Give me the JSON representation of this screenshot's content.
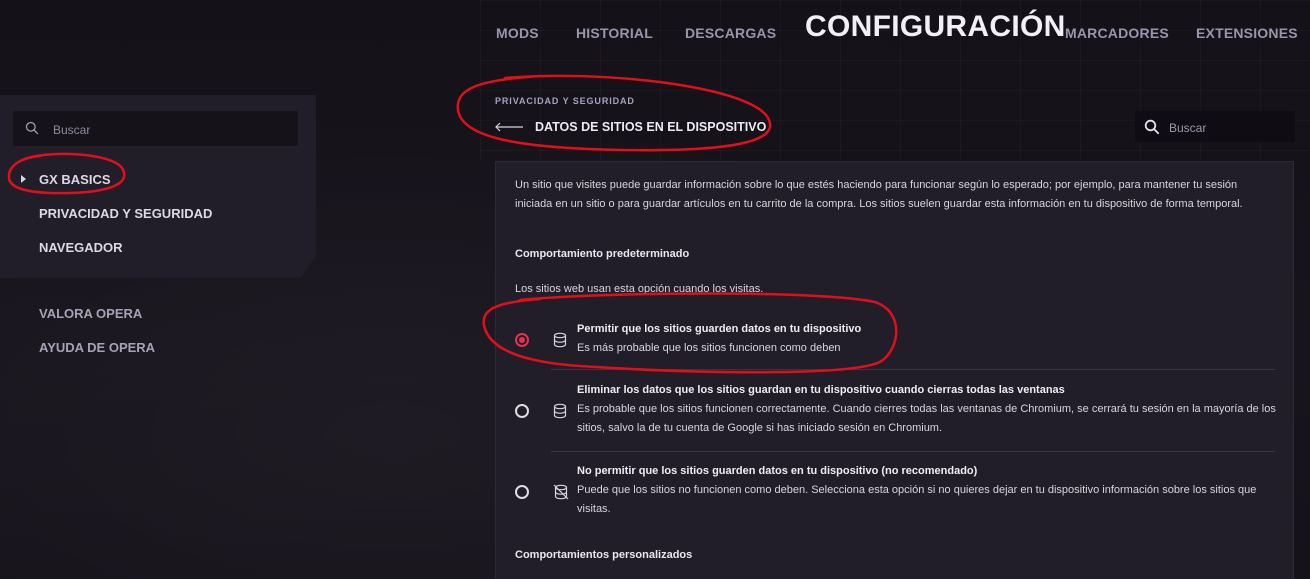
{
  "topnav": {
    "items": [
      {
        "label": "MODS"
      },
      {
        "label": "HISTORIAL"
      },
      {
        "label": "DESCARGAS"
      },
      {
        "label": "MARCADORES"
      },
      {
        "label": "EXTENSIONES"
      }
    ],
    "active": "CONFIGURACIÓN"
  },
  "sidebar": {
    "search_placeholder": "Buscar",
    "items": [
      {
        "label": "GX BASICS"
      },
      {
        "label": "PRIVACIDAD Y SEGURIDAD"
      },
      {
        "label": "NAVEGADOR"
      }
    ],
    "secondary_items": [
      {
        "label": "VALORA OPERA"
      },
      {
        "label": "AYUDA DE OPERA"
      }
    ]
  },
  "header": {
    "breadcrumb": "PRIVACIDAD Y SEGURIDAD",
    "title": "DATOS DE SITIOS EN EL DISPOSITIVO",
    "search_placeholder": "Buscar"
  },
  "content": {
    "description": "Un sitio que visites puede guardar información sobre lo que estés haciendo para funcionar según lo esperado; por ejemplo, para mantener tu sesión iniciada en un sitio o para guardar artículos en tu carrito de la compra. Los sitios suelen guardar esta información en tu dispositivo de forma temporal.",
    "default_heading": "Comportamiento predeterminado",
    "default_sub": "Los sitios web usan esta opción cuando los visitas.",
    "options": [
      {
        "title": "Permitir que los sitios guarden datos en tu dispositivo",
        "desc": "Es más probable que los sitios funcionen como deben",
        "checked": true,
        "icon": "database-icon"
      },
      {
        "title": "Eliminar los datos que los sitios guardan en tu dispositivo cuando cierras todas las ventanas",
        "desc": "Es probable que los sitios funcionen correctamente. Cuando cierres todas las ventanas de Chromium, se cerrará tu sesión en la mayoría de los sitios, salvo la de tu cuenta de Google si has iniciado sesión en Chromium.",
        "checked": false,
        "icon": "database-icon"
      },
      {
        "title": "No permitir que los sitios guarden datos en tu dispositivo (no recomendado)",
        "desc": "Puede que los sitios no funcionen como deben. Selecciona esta opción si no quieres dejar en tu dispositivo información sobre los sitios que visitas.",
        "checked": false,
        "icon": "database-off-icon"
      }
    ],
    "custom_heading": "Comportamientos personalizados"
  },
  "colors": {
    "accent": "#e8304f",
    "annotation": "#e0101a",
    "panel": "#221e29",
    "background": "#141118"
  }
}
